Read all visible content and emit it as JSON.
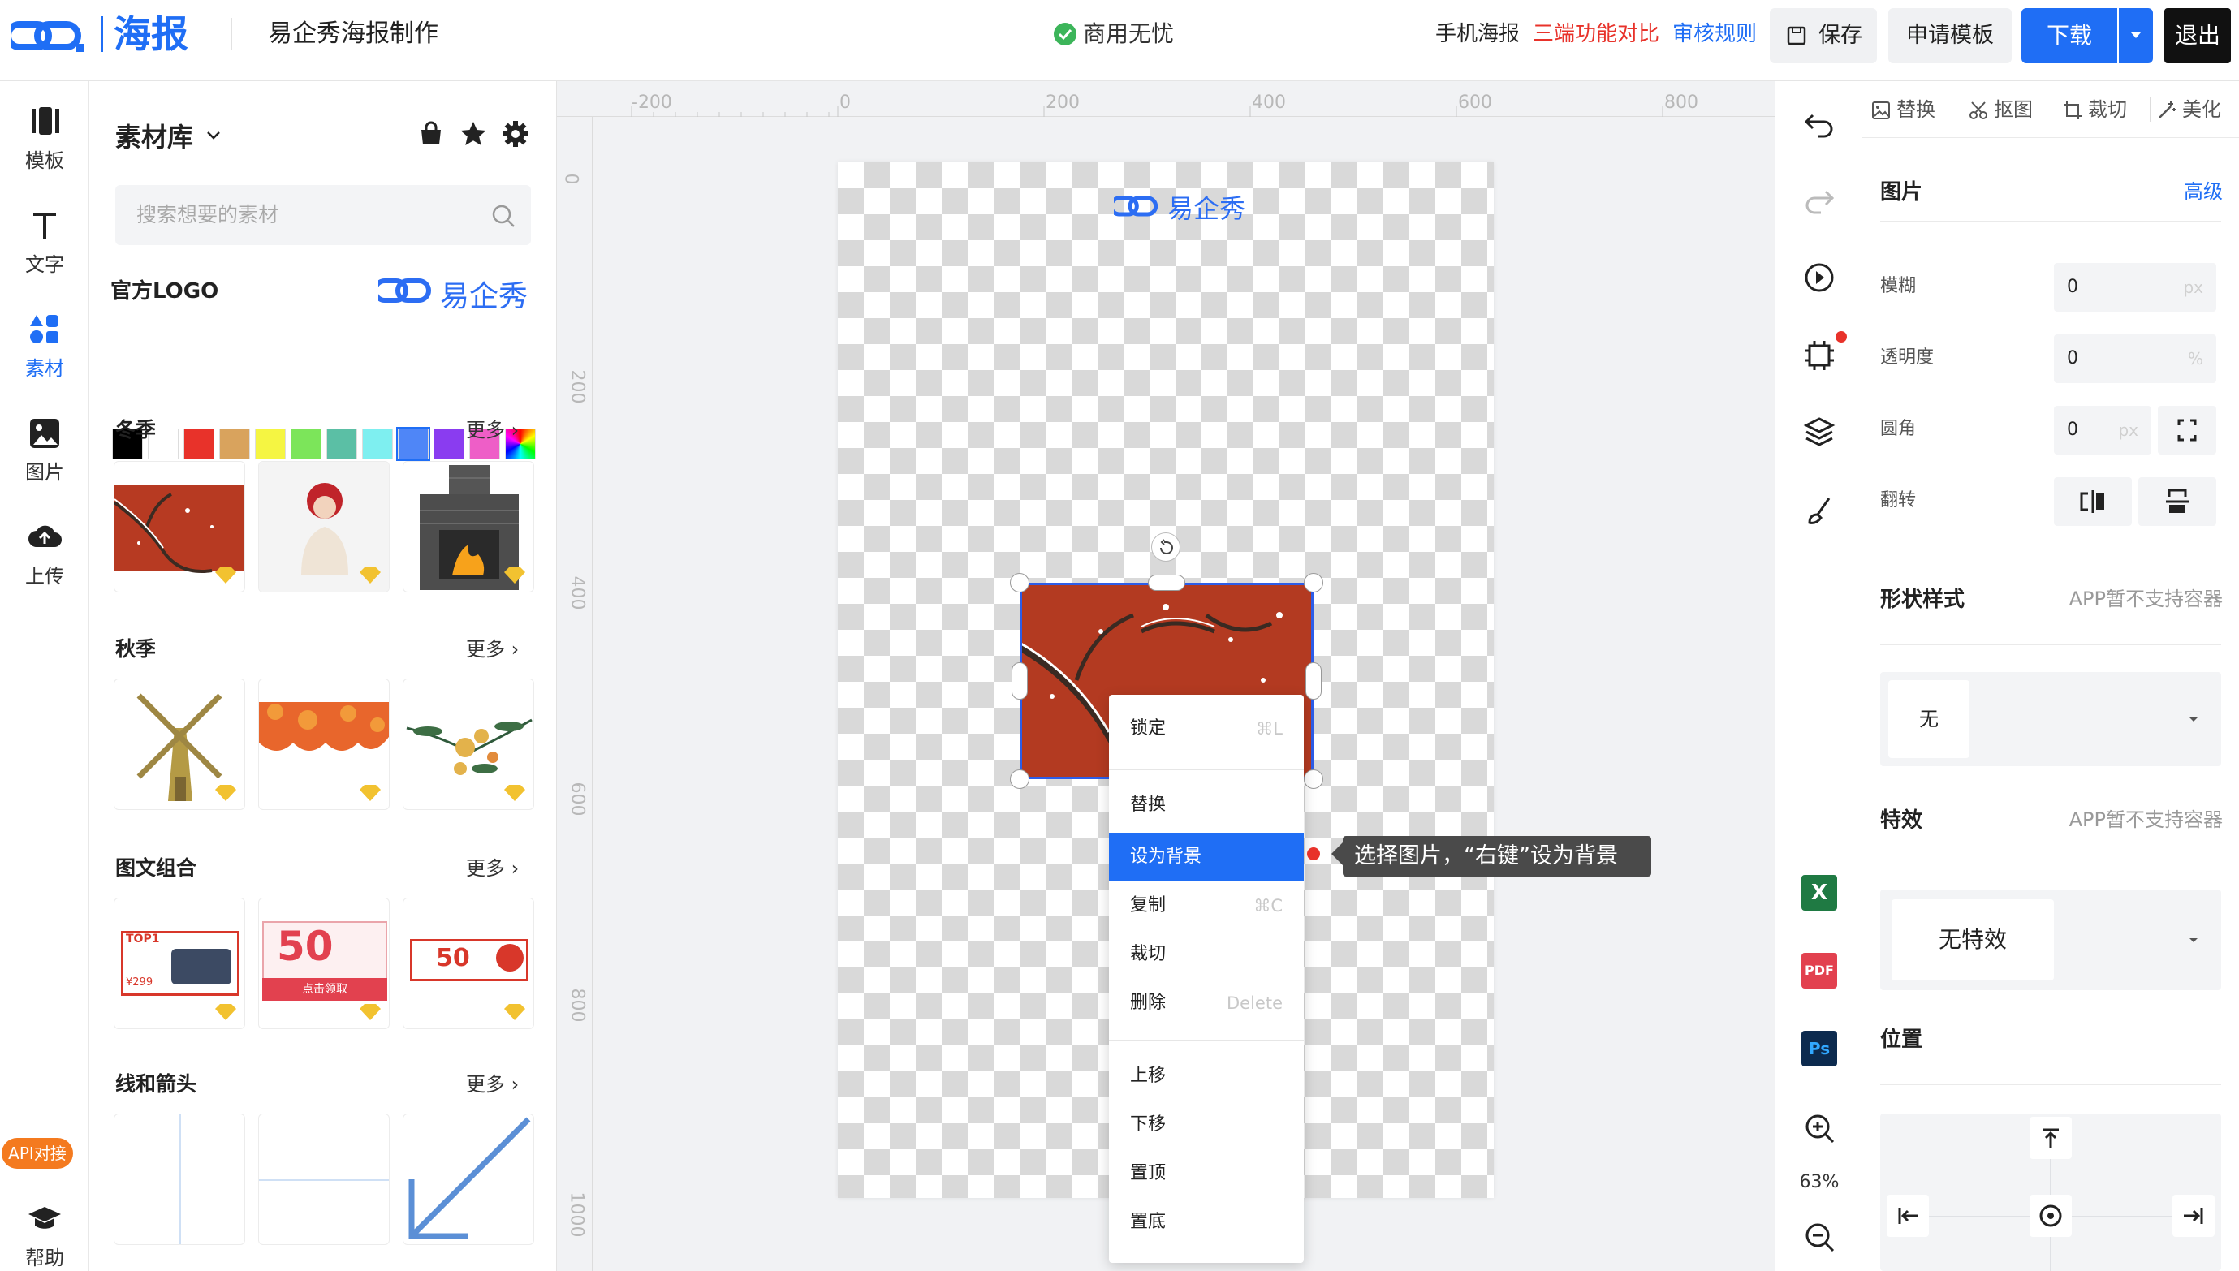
{
  "topbar": {
    "logo_text": "海报",
    "title": "易企秀海报制作",
    "status": "商用无忧",
    "mobile_poster": "手机海报",
    "compare": "三端功能对比",
    "review_rules": "审核规则",
    "save": "保存",
    "apply_template": "申请模板",
    "download": "下载",
    "logout": "退出"
  },
  "toolbar": {
    "items": [
      {
        "label": "模板",
        "icon": "template-icon"
      },
      {
        "label": "文字",
        "icon": "text-icon"
      },
      {
        "label": "素材",
        "icon": "material-icon",
        "active": true
      },
      {
        "label": "图片",
        "icon": "image-icon"
      },
      {
        "label": "上传",
        "icon": "upload-icon"
      }
    ],
    "api_badge": "API对接",
    "help": "帮助"
  },
  "panel": {
    "title": "素材库",
    "search_placeholder": "搜索想要的素材",
    "logo_section": "官方LOGO",
    "logo_brand": "易企秀",
    "swatches": [
      "#000000",
      "#ffffff",
      "#e8322a",
      "#d9a35d",
      "#f5f542",
      "#7ce55a",
      "#5bbfa5",
      "#7eeff0",
      "#4f86f7",
      "#8a3cf0",
      "#ee5ec7",
      "rainbow"
    ],
    "sections": [
      {
        "title": "冬季",
        "more": "更多"
      },
      {
        "title": "秋季",
        "more": "更多"
      },
      {
        "title": "图文组合",
        "more": "更多"
      },
      {
        "title": "线和箭头",
        "more": "更多"
      }
    ],
    "thumb_texts": {
      "top1": "TOP1",
      "price": "¥299",
      "fifty": "50",
      "coupon_btn": "点击领取",
      "fifty2": "50"
    }
  },
  "canvas": {
    "ruler_top": [
      "-200",
      "0",
      "200",
      "400",
      "600",
      "800"
    ],
    "ruler_left": [
      "0",
      "200",
      "400",
      "600",
      "800",
      "1000"
    ],
    "poster_logo": "易企秀",
    "accent": "#1f6ef5"
  },
  "context_menu": {
    "items": [
      {
        "label": "锁定",
        "shortcut": "⌘L"
      },
      {
        "label": "替换",
        "shortcut": ""
      },
      {
        "label": "设为背景",
        "shortcut": ""
      },
      {
        "label": "复制",
        "shortcut": "⌘C"
      },
      {
        "label": "裁切",
        "shortcut": ""
      },
      {
        "label": "删除",
        "shortcut": "Delete"
      },
      {
        "label": "上移",
        "shortcut": ""
      },
      {
        "label": "下移",
        "shortcut": ""
      },
      {
        "label": "置顶",
        "shortcut": ""
      },
      {
        "label": "置底",
        "shortcut": ""
      }
    ],
    "tooltip": "选择图片，“右键”设为背景"
  },
  "right_icons": {
    "zoom": "63%",
    "excel": "X",
    "pdf": "PDF",
    "ps": "Ps"
  },
  "props": {
    "tabs": [
      "替换",
      "抠图",
      "裁切",
      "美化"
    ],
    "section_title": "图片",
    "advanced": "高级",
    "fields": [
      {
        "label": "模糊",
        "value": "0",
        "unit": "px"
      },
      {
        "label": "透明度",
        "value": "0",
        "unit": "%"
      },
      {
        "label": "圆角",
        "value": "0",
        "unit": "px"
      }
    ],
    "flip_label": "翻转",
    "shape_title": "形状样式",
    "shape_note": "APP暂不支持容器",
    "shape_value": "无",
    "effect_title": "特效",
    "effect_note": "APP暂不支持容器",
    "effect_value": "无特效",
    "position_title": "位置"
  }
}
